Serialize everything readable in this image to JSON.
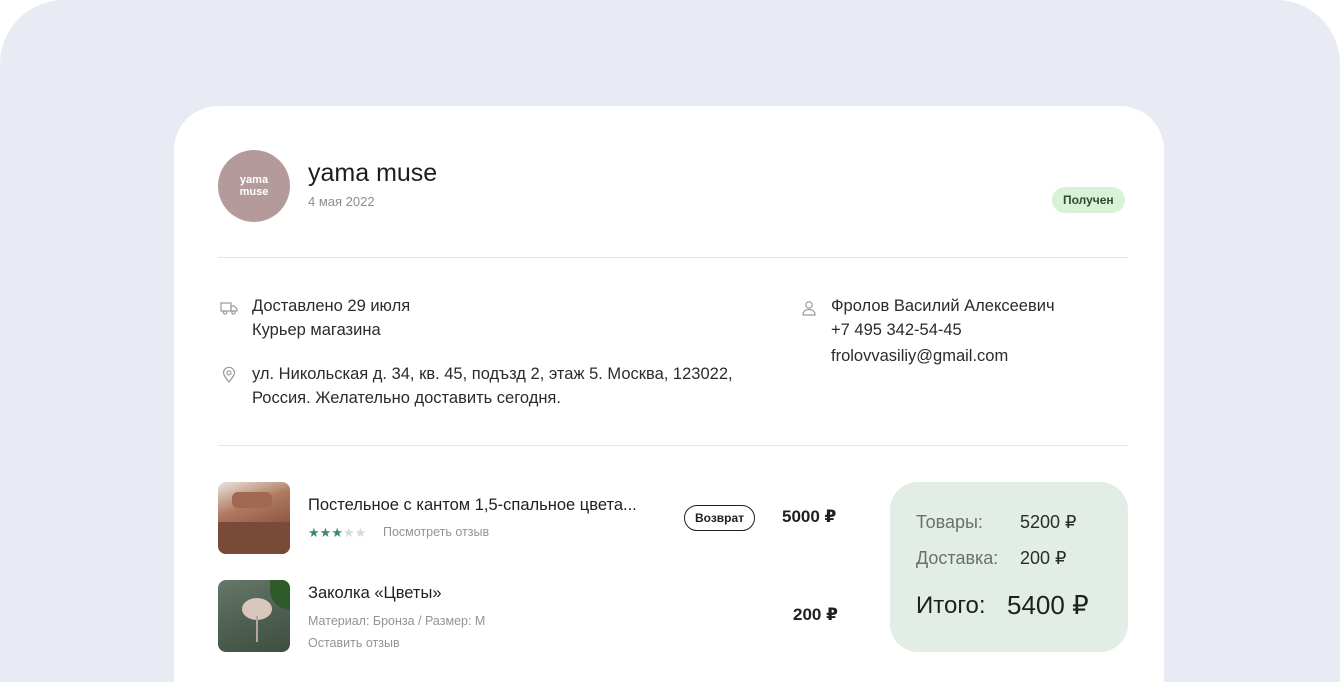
{
  "order": {
    "store_logo_text": "yama\nmuse",
    "store_name": "yama muse",
    "date": "4 мая 2022",
    "status": "Получен"
  },
  "delivery": {
    "delivered": "Доставлено 29 июля",
    "method": "Курьер магазина",
    "address_line1": "ул. Никольская д. 34, кв. 45, подъзд 2, этаж 5. Москва, 123022,",
    "address_line2": "Россия. Желательно доставить сегодня."
  },
  "customer": {
    "name": "Фролов Василий Алексеевич",
    "phone": "+7 495 342-54-45",
    "email": "frolovvasiliy@gmail.com"
  },
  "items": [
    {
      "title": "Постельное с кантом 1,5-спальное цвета...",
      "rating": 3,
      "rating_max": 5,
      "review_link": "Посмотреть отзыв",
      "action": "Возврат",
      "price": "5000 ₽"
    },
    {
      "title": "Заколка «Цветы»",
      "details": "Материал: Бронза / Размер: M",
      "review_link": "Оставить отзыв",
      "price": "200 ₽"
    }
  ],
  "summary": {
    "goods_label": "Товары:",
    "goods_value": "5200 ₽",
    "delivery_label": "Доставка:",
    "delivery_value": "200 ₽",
    "total_label": "Итого:",
    "total_value": "5400 ₽"
  },
  "colors": {
    "background": "#e8ebf3",
    "status_bg": "#d9f2d7",
    "summary_bg": "#e2ede6",
    "star": "#3f8a63",
    "logo_bg": "#b59a9c"
  },
  "icons": {
    "delivery": "truck-icon",
    "address": "location-pin-icon",
    "customer": "user-icon"
  }
}
